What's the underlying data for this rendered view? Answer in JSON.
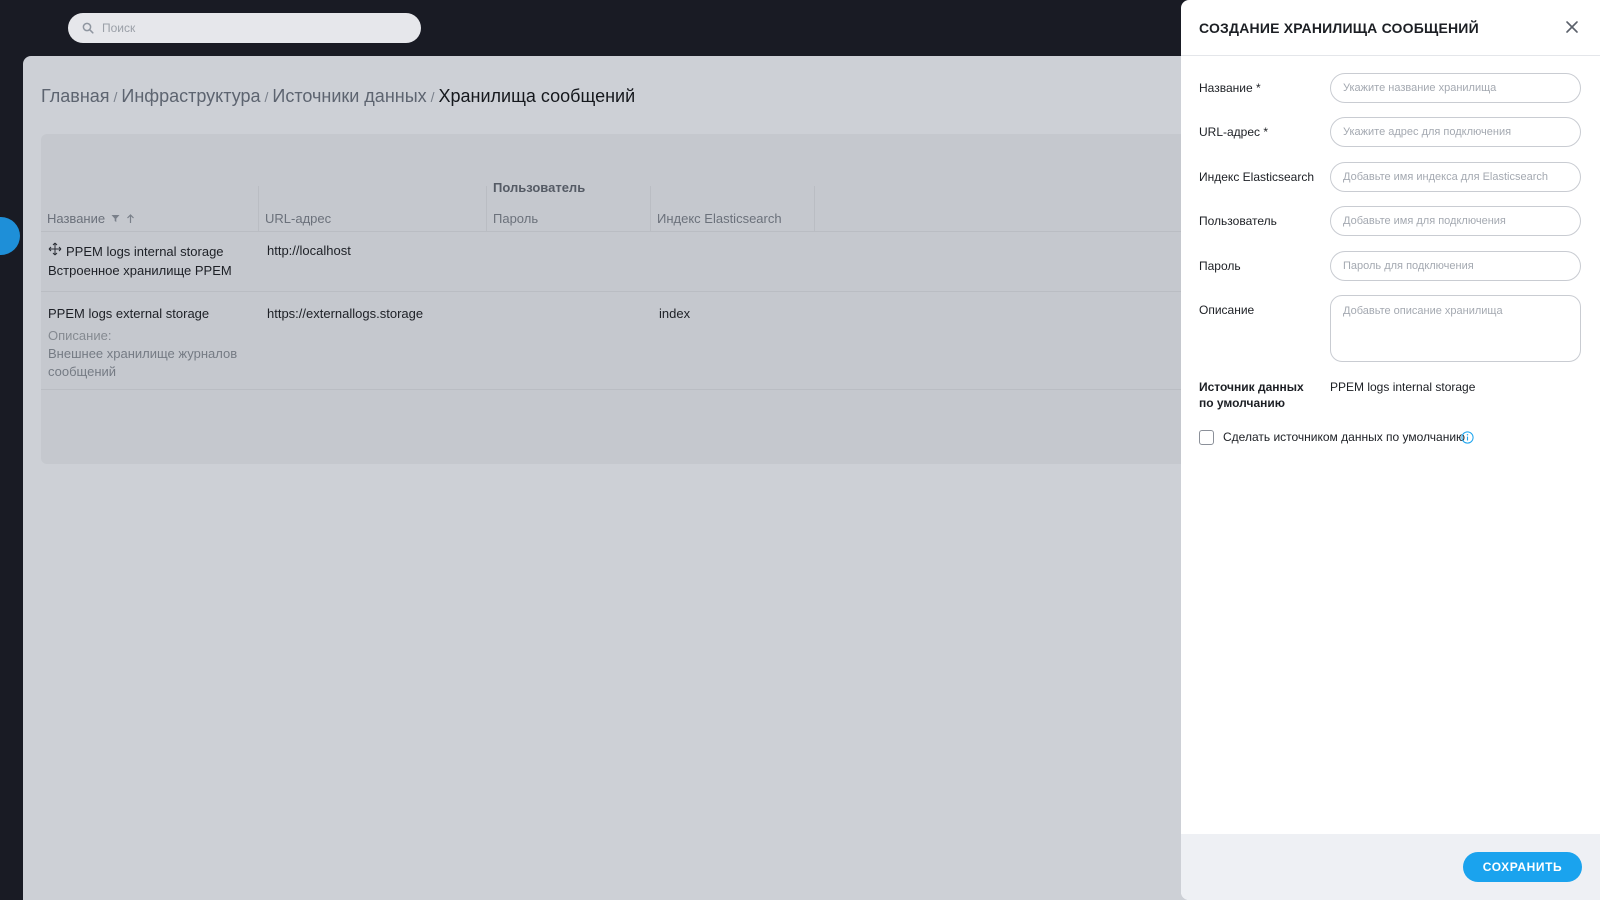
{
  "search": {
    "placeholder": "Поиск"
  },
  "breadcrumb": {
    "items": [
      "Главная",
      "Инфраструктура",
      "Источники данных"
    ],
    "separator": "/",
    "current": "Хранилища сообщений"
  },
  "table": {
    "columns": {
      "name": "Название",
      "url": "URL-адрес",
      "user": "Пользователь",
      "password": "Пароль",
      "index": "Индекс Elasticsearch"
    },
    "rows": [
      {
        "name": "PPEM logs internal storage",
        "subtitle": "Встроенное хранилище PPEM",
        "url": "http://localhost",
        "index": ""
      },
      {
        "name": "PPEM logs external storage",
        "description_label": "Описание:",
        "description_line1": "Внешнее хранилище журналов",
        "description_line2": "сообщений",
        "url": "https://externallogs.storage",
        "index": "index"
      }
    ]
  },
  "drawer": {
    "title": "СОЗДАНИЕ ХРАНИЛИЩА СООБЩЕНИЙ",
    "fields": {
      "name": {
        "label": "Название *",
        "placeholder": "Укажите название хранилища"
      },
      "url": {
        "label": "URL-адрес *",
        "placeholder": "Укажите адрес для подключения"
      },
      "index": {
        "label": "Индекс Elasticsearch",
        "placeholder": "Добавьте имя индекса для Elasticsearch"
      },
      "user": {
        "label": "Пользователь",
        "placeholder": "Добавьте имя для подключения"
      },
      "password": {
        "label": "Пароль",
        "placeholder": "Пароль для подключения"
      },
      "description": {
        "label": "Описание",
        "placeholder": "Добавьте описание хранилища"
      }
    },
    "default_source": {
      "label_line1": "Источник данных",
      "label_line2": "по умолчанию",
      "value": "PPEM logs internal storage"
    },
    "checkbox_label": "Сделать источником данных по умолчанию",
    "save_label": "СОХРАНИТЬ"
  },
  "colors": {
    "accent": "#1aa3ee",
    "overlay": "#cdd0d6",
    "background": "#191b24"
  }
}
